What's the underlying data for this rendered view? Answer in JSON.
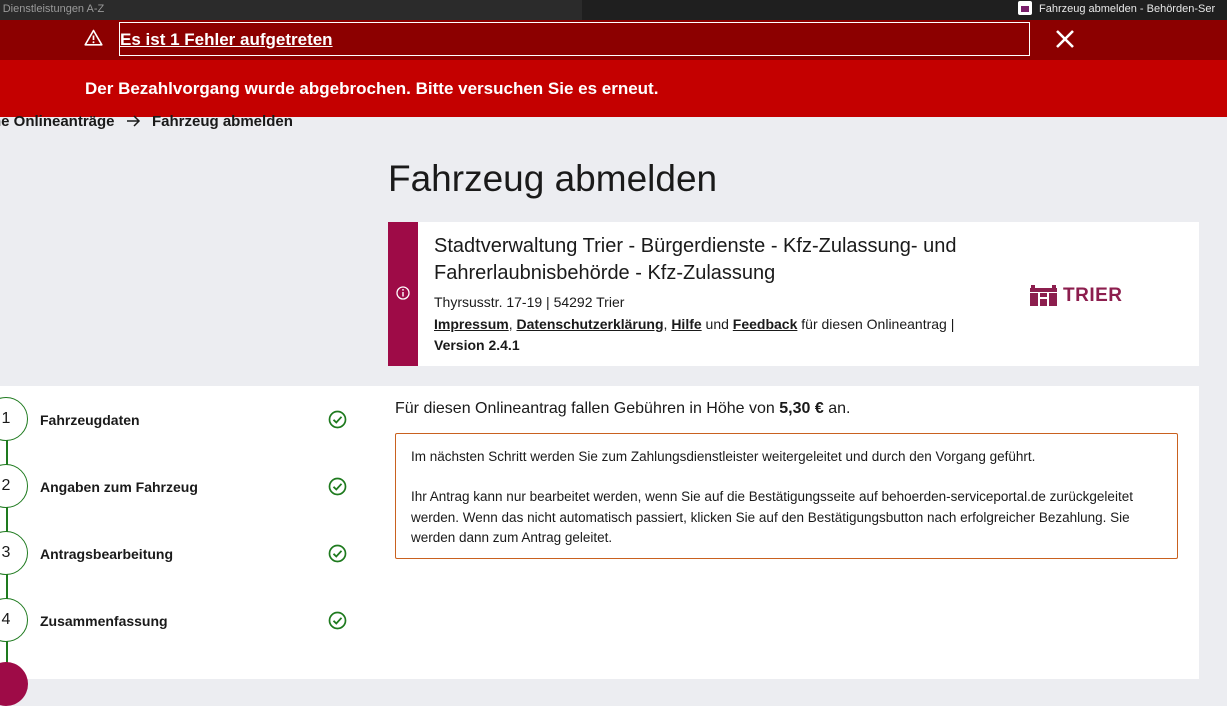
{
  "browser": {
    "tab_left_title": "- Dienstleistungen A-Z",
    "tab_active_title": "Fahrzeug abmelden - Behörden-Ser"
  },
  "error": {
    "headline": "Es ist 1 Fehler aufgetreten",
    "message": "Der Bezahlvorgang wurde abgebrochen. Bitte versuchen Sie es erneut.",
    "header_color": "#8c0000",
    "body_color": "#c40000"
  },
  "breadcrumb": {
    "items": [
      "ne Onlineanträge",
      "Fahrzeug abmelden"
    ]
  },
  "page": {
    "title": "Fahrzeug abmelden"
  },
  "authority": {
    "name": "Stadtverwaltung Trier - Bürgerdienste - Kfz-Zulassung- und Fahrerlaubnisbehörde - Kfz-Zulassung",
    "address": "Thyrsusstr. 17-19 | 54292 Trier",
    "links": {
      "impressum": "Impressum",
      "datenschutz": "Datenschutzerklärung",
      "hilfe": "Hilfe",
      "und": "und",
      "feedback": "Feedback",
      "suffix": "für diesen Onlineantrag |"
    },
    "version": "Version 2.4.1",
    "logo_text": "TRIER",
    "accent_color": "#9e0b47"
  },
  "steps": [
    {
      "number": "1",
      "label": "Fahrzeugdaten",
      "status": "done"
    },
    {
      "number": "2",
      "label": "Angaben zum Fahrzeug",
      "status": "done"
    },
    {
      "number": "3",
      "label": "Antragsbearbeitung",
      "status": "done"
    },
    {
      "number": "4",
      "label": "Zusammenfassung",
      "status": "done"
    }
  ],
  "payment": {
    "fee_prefix": "Für diesen Onlineantrag fallen Gebühren in Höhe von",
    "fee_amount": "5,30 €",
    "fee_suffix": "an.",
    "notice_p1": "Im nächsten Schritt werden Sie zum Zahlungsdienstleister weitergeleitet und durch den Vorgang geführt.",
    "notice_p2": "Ihr Antrag kann nur bearbeitet werden, wenn Sie auf die Bestätigungsseite auf behoerden-serviceportal.de zurückgeleitet werden. Wenn das nicht automatisch passiert, klicken Sie auf den Bestätigungsbutton nach erfolgreicher Bezahlung. Sie werden dann zum Antrag geleitet.",
    "notice_border_color": "#c9611f"
  },
  "icons": {
    "warning": "warning-icon",
    "close": "close-icon",
    "info": "info-icon",
    "check": "check-circle-icon",
    "arrow": "arrow-right-icon"
  }
}
